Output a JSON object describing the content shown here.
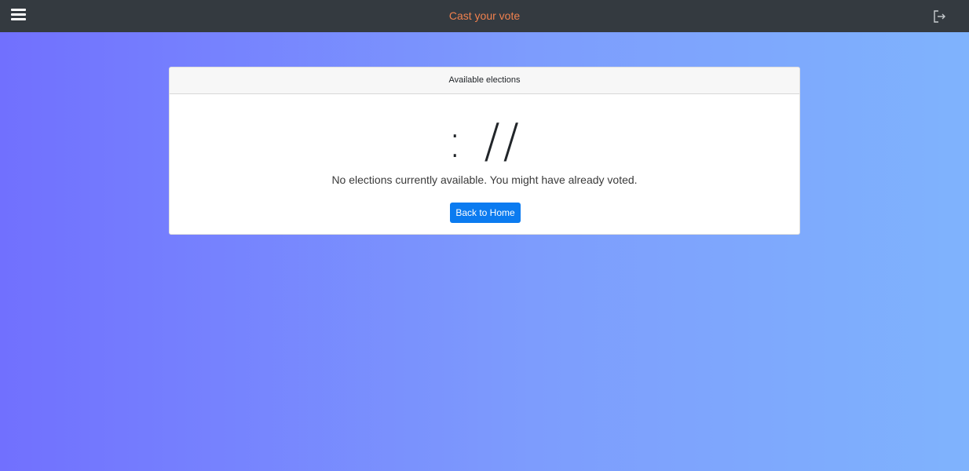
{
  "navbar": {
    "title": "Cast your vote",
    "menu_icon": "hamburger-menu-icon",
    "logout_icon": "logout-icon",
    "title_color": "#f0814e",
    "background": "#343a40"
  },
  "card": {
    "header": "Available elections",
    "emoticon": ": //",
    "message": "No elections currently available. You might have already voted.",
    "button_label": "Back to Home",
    "button_color": "#0b7bf0"
  }
}
